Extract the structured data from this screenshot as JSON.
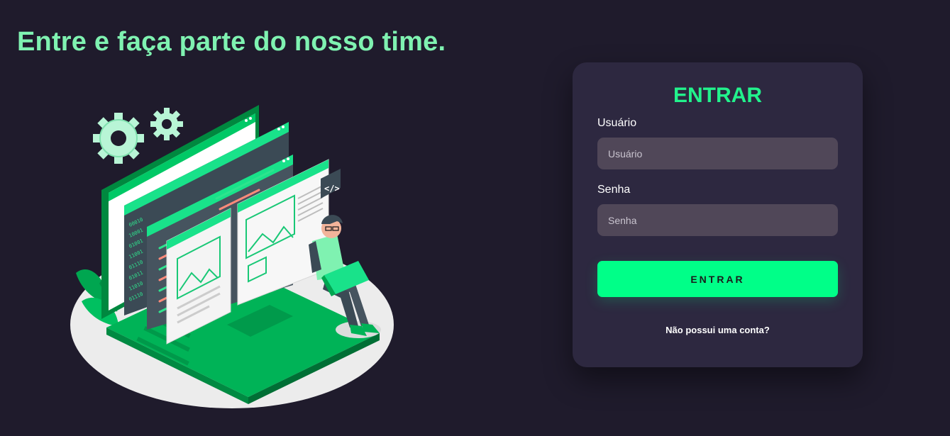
{
  "hero": {
    "headline": "Entre e faça parte do nosso time."
  },
  "illustration": {
    "icon": "developer-laptop-illustration",
    "code_tag": "</>"
  },
  "login": {
    "title": "ENTRAR",
    "username_label": "Usuário",
    "username_placeholder": "Usuário",
    "username_value": "",
    "password_label": "Senha",
    "password_placeholder": "Senha",
    "password_value": "",
    "submit_label": "ENTRAR",
    "signup_link": "Não possui uma conta?"
  },
  "colors": {
    "background": "#1f1b2c",
    "headline": "#7ff2b1",
    "accent": "#00ff88",
    "card": "#2d2840",
    "input": "#504758"
  }
}
